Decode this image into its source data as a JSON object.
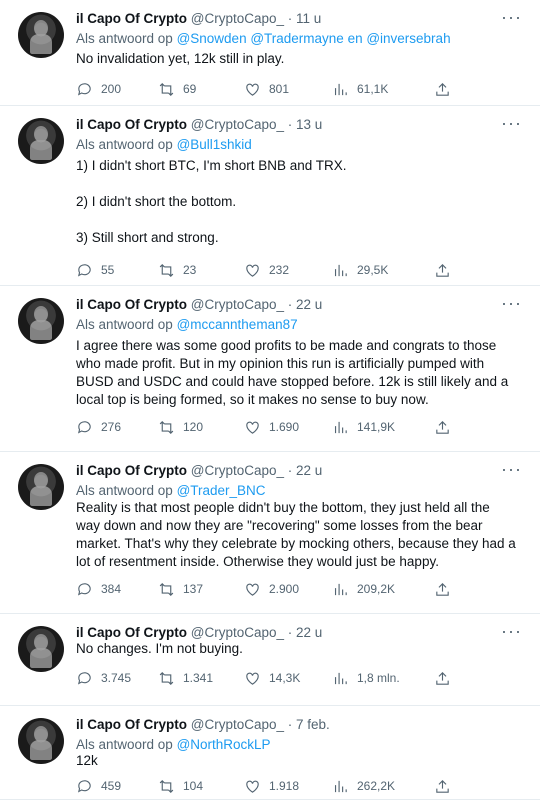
{
  "tweets": [
    {
      "name": "il Capo Of Crypto",
      "handle": "@CryptoCapo_",
      "time": "· 11 u",
      "reply_prefix": "Als antwoord op",
      "mentions": "@Snowden @Tradermayne en @inversebrah",
      "lines": [
        "No invalidation yet, 12k still in play."
      ],
      "replies": "200",
      "retweets": "69",
      "likes": "801",
      "views": "61,1K"
    },
    {
      "name": "il Capo Of Crypto",
      "handle": "@CryptoCapo_",
      "time": "· 13 u",
      "reply_prefix": "Als antwoord op",
      "mentions": "@Bull1shkid",
      "lines": [
        "1) I didn't short BTC, I'm short BNB and TRX.",
        "",
        "2) I didn't short the bottom.",
        "",
        "3) Still short and strong."
      ],
      "replies": "55",
      "retweets": "23",
      "likes": "232",
      "views": "29,5K"
    },
    {
      "name": "il Capo Of Crypto",
      "handle": "@CryptoCapo_",
      "time": "· 22 u",
      "reply_prefix": "Als antwoord op",
      "mentions": "@mccanntheman87",
      "lines": [
        "I agree there was some good profits to be made and congrats to those",
        "who made profit. But in my opinion this run is artificially pumped with",
        "BUSD and USDC and could have stopped before. 12k is still likely and a",
        "local top is being formed, so it makes no sense to buy now."
      ],
      "replies": "276",
      "retweets": "120",
      "likes": "1.690",
      "views": "141,9K"
    },
    {
      "name": "il Capo Of Crypto",
      "handle": "@CryptoCapo_",
      "time": "· 22 u",
      "reply_prefix": "Als antwoord op",
      "mentions": "@Trader_BNC",
      "lines": [
        "Reality is that most people didn't buy the bottom, they just held all the",
        "way down and now they are \"recovering\" some losses from the bear",
        "market. That's why they celebrate by mocking others, because they had a",
        "lot of resentment inside. Otherwise they would just be happy."
      ],
      "replies": "384",
      "retweets": "137",
      "likes": "2.900",
      "views": "209,2K"
    },
    {
      "name": "il Capo Of Crypto",
      "handle": "@CryptoCapo_",
      "time": "· 22 u",
      "reply_prefix": "",
      "mentions": "",
      "lines": [
        "No changes. I'm not buying."
      ],
      "replies": "3.745",
      "retweets": "1.341",
      "likes": "14,3K",
      "views": "1,8 mln."
    },
    {
      "name": "il Capo Of Crypto",
      "handle": "@CryptoCapo_",
      "time": "· 7 feb.",
      "reply_prefix": "Als antwoord op",
      "mentions": "@NorthRockLP",
      "lines": [
        "12k"
      ],
      "replies": "459",
      "retweets": "104",
      "likes": "1.918",
      "views": "262,2K"
    }
  ],
  "more_label": "···"
}
